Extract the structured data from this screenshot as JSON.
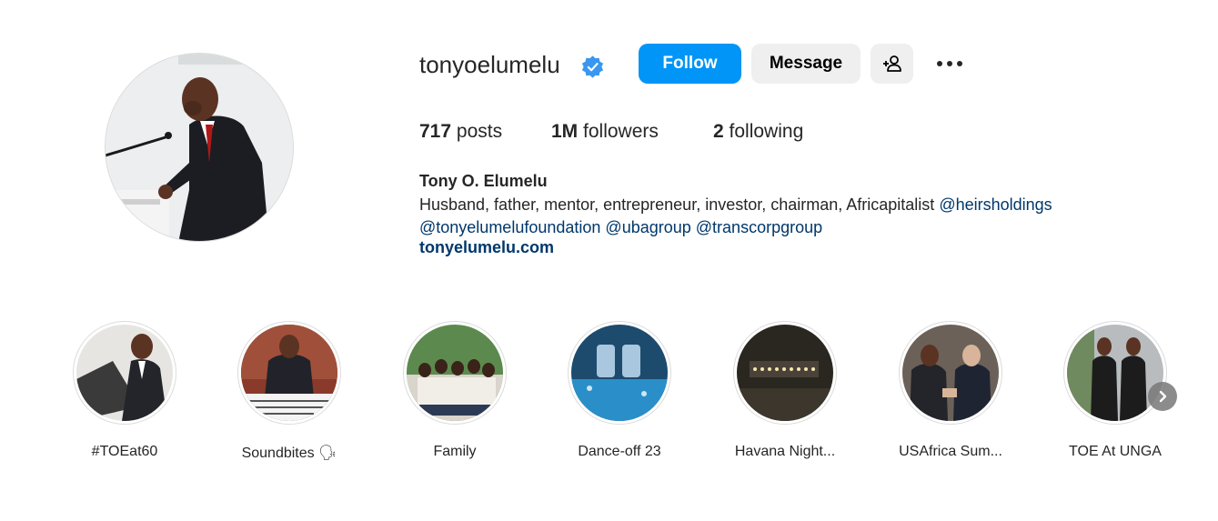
{
  "profile": {
    "username": "tonyoelumelu",
    "verified": true,
    "full_name": "Tony O. Elumelu",
    "bio_text": "Husband, father, mentor, entrepreneur, investor, chairman, Africapitalist",
    "bio_mentions": [
      "@heirsholdings",
      "@tonyelumelufoundation",
      "@ubagroup",
      "@transcorpgroup"
    ],
    "website": "tonyelumelu.com"
  },
  "actions": {
    "follow_label": "Follow",
    "message_label": "Message",
    "add_user_icon": "add-person-icon",
    "more_icon": "more-options-icon"
  },
  "stats": {
    "posts_count": "717",
    "posts_label": "posts",
    "followers_count": "1M",
    "followers_label": "followers",
    "following_count": "2",
    "following_label": "following"
  },
  "highlights": [
    {
      "label": "#TOEat60"
    },
    {
      "label": "Soundbites 🗣"
    },
    {
      "label": "Family"
    },
    {
      "label": "Dance-off 23"
    },
    {
      "label": "Havana Night..."
    },
    {
      "label": "USAfrica Sum..."
    },
    {
      "label": "TOE At UNGA"
    }
  ],
  "colors": {
    "accent": "#0095f6",
    "link": "#00376b",
    "button_bg": "#efefef",
    "verified": "#3897f0"
  }
}
